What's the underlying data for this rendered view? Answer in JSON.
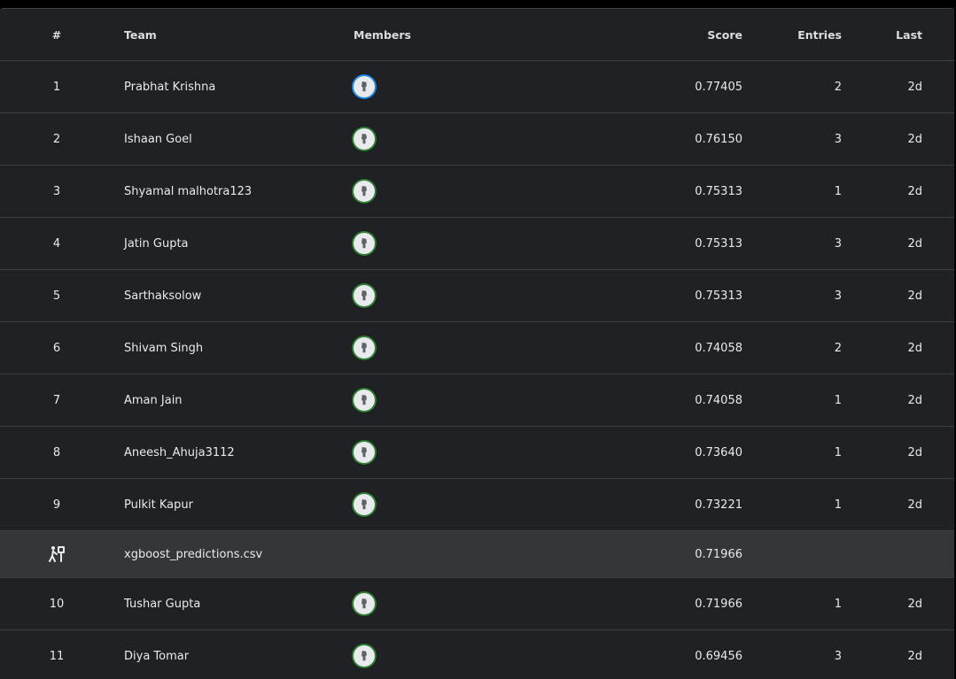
{
  "header": {
    "rank": "#",
    "team": "Team",
    "members": "Members",
    "score": "Score",
    "entries": "Entries",
    "last": "Last"
  },
  "rows": [
    {
      "rank": "1",
      "team": "Prabhat Krishna",
      "score": "0.77405",
      "entries": "2",
      "last": "2d",
      "avatar_ring": "#1e88e5"
    },
    {
      "rank": "2",
      "team": "Ishaan Goel",
      "score": "0.76150",
      "entries": "3",
      "last": "2d",
      "avatar_ring": "#2e7d32"
    },
    {
      "rank": "3",
      "team": "Shyamal malhotra123",
      "score": "0.75313",
      "entries": "1",
      "last": "2d",
      "avatar_ring": "#2e7d32"
    },
    {
      "rank": "4",
      "team": "Jatin Gupta",
      "score": "0.75313",
      "entries": "3",
      "last": "2d",
      "avatar_ring": "#2e7d32"
    },
    {
      "rank": "5",
      "team": "Sarthaksolow",
      "score": "0.75313",
      "entries": "3",
      "last": "2d",
      "avatar_ring": "#2e7d32"
    },
    {
      "rank": "6",
      "team": "Shivam Singh",
      "score": "0.74058",
      "entries": "2",
      "last": "2d",
      "avatar_ring": "#2e7d32"
    },
    {
      "rank": "7",
      "team": "Aman Jain",
      "score": "0.74058",
      "entries": "1",
      "last": "2d",
      "avatar_ring": "#2e7d32"
    },
    {
      "rank": "8",
      "team": "Aneesh_Ahuja3112",
      "score": "0.73640",
      "entries": "1",
      "last": "2d",
      "avatar_ring": "#2e7d32"
    },
    {
      "rank": "9",
      "team": "Pulkit Kapur",
      "score": "0.73221",
      "entries": "1",
      "last": "2d",
      "avatar_ring": "#2e7d32"
    }
  ],
  "submission": {
    "icon": "submission-icon",
    "filename": "xgboost_predictions.csv",
    "score": "0.71966"
  },
  "rows_after": [
    {
      "rank": "10",
      "team": "Tushar Gupta",
      "score": "0.71966",
      "entries": "1",
      "last": "2d",
      "avatar_ring": "#2e7d32"
    },
    {
      "rank": "11",
      "team": "Diya Tomar",
      "score": "0.69456",
      "entries": "3",
      "last": "2d",
      "avatar_ring": "#2e7d32"
    }
  ],
  "colors": {
    "background": "#202124",
    "submission_row": "#35363a",
    "divider": "#3c4043",
    "text": "#e8eaed"
  }
}
